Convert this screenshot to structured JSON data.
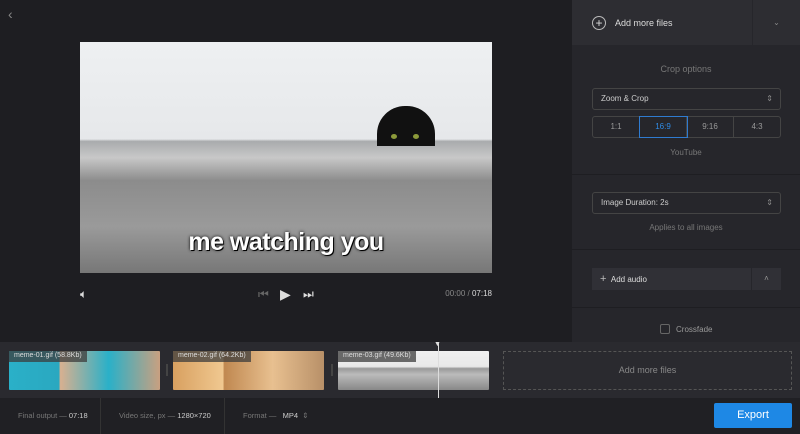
{
  "nav": {
    "back_icon": "chevron-left-icon"
  },
  "player": {
    "caption": "me watching you",
    "time_current": "00:00",
    "time_total": "07:18"
  },
  "sidebar": {
    "add_files": "Add more files",
    "crop_title": "Crop options",
    "crop_mode": "Zoom & Crop",
    "ratios": [
      "1:1",
      "16:9",
      "9:16",
      "4:3"
    ],
    "selected_ratio": "16:9",
    "ratio_hint": "YouTube",
    "duration": "Image Duration: 2s",
    "duration_hint": "Applies to all images",
    "add_audio": "Add audio",
    "crossfade": "Crossfade",
    "accent": "#1e88e5"
  },
  "timeline": {
    "clips": [
      {
        "name": "meme-01.gif (58.8Kb)"
      },
      {
        "name": "meme-02.gif (64.2Kb)"
      },
      {
        "name": "meme-03.gif (49.6Kb)"
      }
    ],
    "add_more": "Add more files"
  },
  "footer": {
    "final_label": "Final output —",
    "final_value": "07:18",
    "size_label": "Video size, px —",
    "size_value": "1280×720",
    "format_label": "Format —",
    "format_value": "MP4",
    "export": "Export"
  }
}
